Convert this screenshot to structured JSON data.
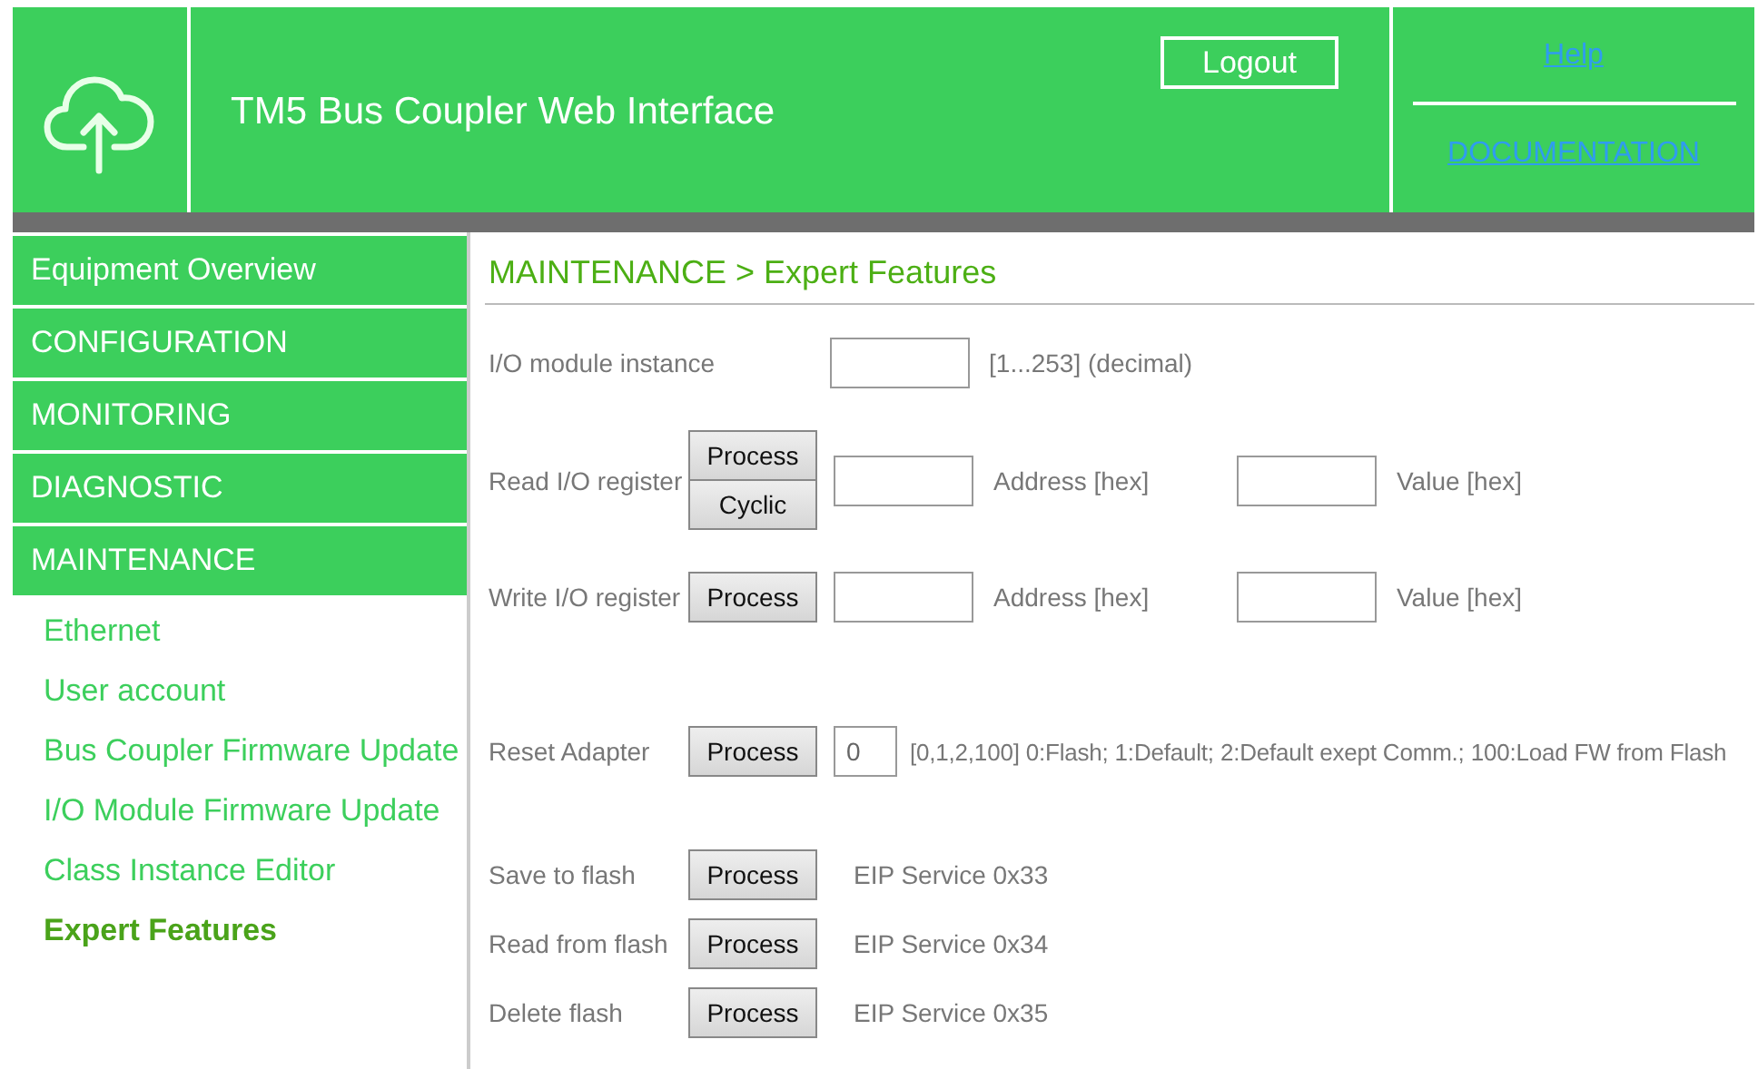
{
  "header": {
    "title": "TM5 Bus Coupler Web Interface",
    "logout": "Logout",
    "links": [
      "Help",
      "DOCUMENTATION"
    ]
  },
  "nav": {
    "sections": [
      {
        "label": "Equipment Overview"
      },
      {
        "label": "CONFIGURATION"
      },
      {
        "label": "MONITORING"
      },
      {
        "label": "DIAGNOSTIC"
      },
      {
        "label": "MAINTENANCE",
        "children": [
          {
            "label": "Ethernet",
            "selected": false
          },
          {
            "label": "User account",
            "selected": false
          },
          {
            "label": "Bus Coupler Firmware Update",
            "selected": false
          },
          {
            "label": "I/O Module Firmware Update",
            "selected": false
          },
          {
            "label": "Class Instance Editor",
            "selected": false
          },
          {
            "label": "Expert Features",
            "selected": true
          }
        ]
      }
    ]
  },
  "breadcrumb": "MAINTENANCE > Expert Features",
  "rows": [
    {
      "kind": "instance",
      "label": "I/O module instance",
      "buttons": [],
      "fields": [
        {
          "kind": "wide",
          "caption": "[1...253] (decimal)"
        }
      ]
    },
    {
      "kind": "register",
      "label": "Read I/O register",
      "buttons": [
        "Process",
        "Cyclic"
      ],
      "fields": [
        {
          "kind": "wide",
          "caption": "Address [hex]"
        },
        {
          "kind": "wide",
          "caption": "Value [hex]"
        }
      ]
    },
    {
      "kind": "register",
      "label": "Write I/O register",
      "buttons": [
        "Process"
      ],
      "fields": [
        {
          "kind": "wide",
          "caption": "Address [hex]"
        },
        {
          "kind": "wide",
          "caption": "Value [hex]"
        }
      ]
    },
    {
      "kind": "reset",
      "label": "Reset Adapter",
      "buttons": [
        "Process"
      ],
      "fields": [
        {
          "kind": "short",
          "value": "0",
          "caption": "[0,1,2,100]  0:Flash; 1:Default; 2:Default exept Comm.; 100:Load FW from Flash"
        }
      ]
    },
    {
      "kind": "flash",
      "label": "Save to flash",
      "buttons": [
        "Process"
      ],
      "note": "EIP Service 0x33"
    },
    {
      "kind": "flash",
      "label": "Read from flash",
      "buttons": [
        "Process"
      ],
      "note": "EIP Service 0x34"
    },
    {
      "kind": "flash",
      "label": "Delete flash",
      "buttons": [
        "Process"
      ],
      "note": "EIP Service 0x35"
    }
  ]
}
